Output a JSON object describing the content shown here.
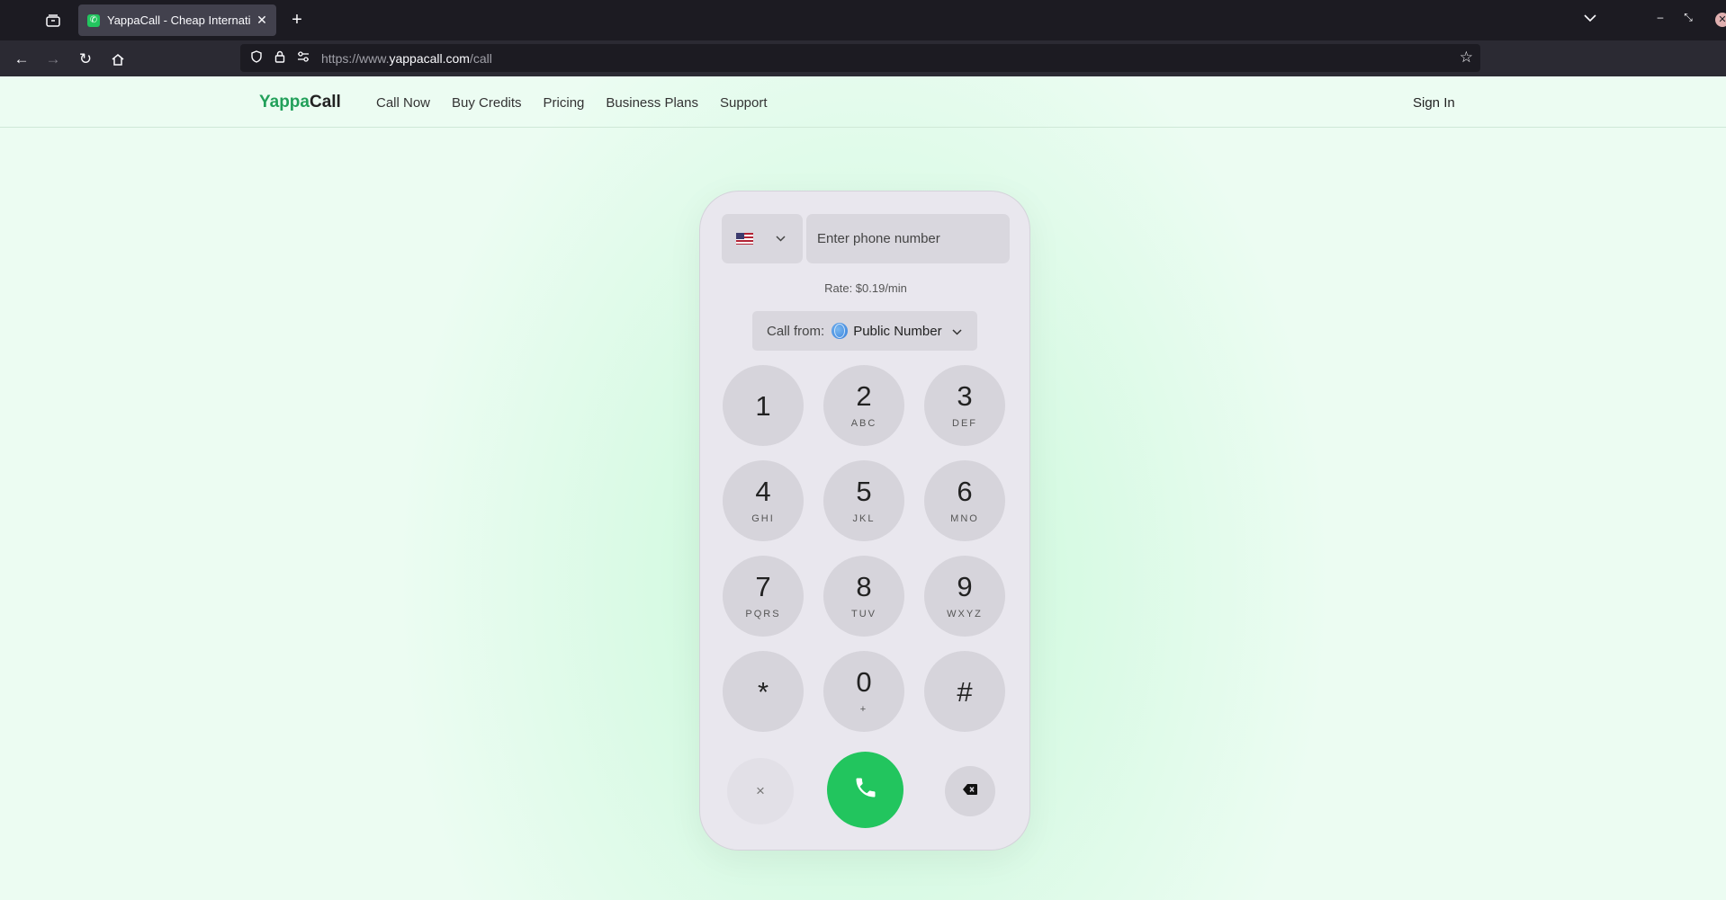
{
  "browser": {
    "tab_title": "YappaCall - Cheap Internatio",
    "url_prefix": "https://www.",
    "url_domain": "yappacall.com",
    "url_path": "/call"
  },
  "site": {
    "logo_a": "Yappa",
    "logo_b": "Call",
    "menu": [
      "Call Now",
      "Buy Credits",
      "Pricing",
      "Business Plans",
      "Support"
    ],
    "sign_in": "Sign In"
  },
  "dialer": {
    "country_flag": "us-flag",
    "phone_placeholder": "Enter phone number",
    "rate": "Rate: $0.19/min",
    "call_from_label": "Call from:",
    "call_from_value": "Public Number",
    "keys": [
      {
        "digit": "1",
        "letters": ""
      },
      {
        "digit": "2",
        "letters": "ABC"
      },
      {
        "digit": "3",
        "letters": "DEF"
      },
      {
        "digit": "4",
        "letters": "GHI"
      },
      {
        "digit": "5",
        "letters": "JKL"
      },
      {
        "digit": "6",
        "letters": "MNO"
      },
      {
        "digit": "7",
        "letters": "PQRS"
      },
      {
        "digit": "8",
        "letters": "TUV"
      },
      {
        "digit": "9",
        "letters": "WXYZ"
      },
      {
        "digit": "*",
        "letters": ""
      },
      {
        "digit": "0",
        "letters": "+"
      },
      {
        "digit": "#",
        "letters": ""
      }
    ],
    "clear_symbol": "×",
    "accent": "#22c55e"
  }
}
